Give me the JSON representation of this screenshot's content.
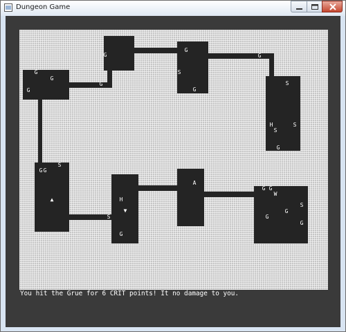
{
  "window": {
    "title": "Dungeon Game"
  },
  "icons": {
    "app": "app-icon",
    "minimize": "minimize-icon",
    "maximize": "maximize-icon",
    "close": "close-icon"
  },
  "colors": {
    "floor": "#c6c6c6",
    "wall": "#242424",
    "frame": "#3a3a3a",
    "text": "#ffffff"
  },
  "game": {
    "legend": {
      "player": "▲",
      "gold": "G",
      "serpent": "S",
      "health": "H",
      "weapon": "W",
      "armor": "A",
      "stairs": "▼"
    },
    "message": "You hit the Grue for 6 CRIT points! It no damage to you."
  }
}
